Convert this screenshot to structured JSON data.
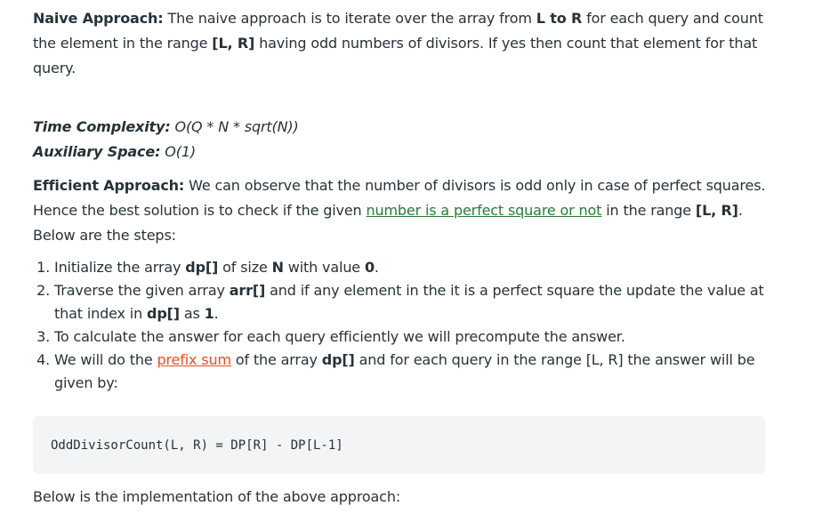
{
  "naive": {
    "label": "Naive Approach:",
    "text_1": " The naive approach is to iterate over the array from ",
    "bold_range": "L to R",
    "text_2": " for each query and count the element in the range ",
    "bold_lr": "[L, R]",
    "text_3": " having odd numbers of divisors. If yes then count that element for that query."
  },
  "complexity": {
    "time_label": "Time Complexity:",
    "time_value": " O(Q * N * sqrt(N))",
    "space_label": "Auxiliary Space:",
    "space_value": " O(1)"
  },
  "efficient": {
    "label": "Efficient Approach:",
    "text_1": " We can observe that the number of divisors is odd only in case of perfect squares. Hence the best solution is to check if the given ",
    "link_text": "number is a perfect square or not",
    "text_2": " in the range ",
    "bold_lr": "[L, R]",
    "text_3": ". Below are the steps:"
  },
  "steps": [
    {
      "t1": "Initialize the array ",
      "b1": "dp[]",
      "t2": " of size ",
      "b2": "N",
      "t3": " with value ",
      "b3": "0",
      "t4": "."
    },
    {
      "t1": "Traverse the given array ",
      "b1": "arr[]",
      "t2": " and if any element in the it is a perfect square the update the value at that index in ",
      "b2": "dp[]",
      "t3": " as ",
      "b3": "1",
      "t4": "."
    },
    {
      "t1": "To calculate the answer for each query efficiently we will precompute the answer."
    },
    {
      "t1": "We will do the ",
      "link": "prefix sum",
      "t2": " of the array ",
      "b1": "dp[]",
      "t3": " and for each query in the range [L, R] the answer will be given by:"
    }
  ],
  "code": "OddDivisorCount(L, R) = DP[R] - DP[L-1]",
  "below": "Below is the implementation of the above approach:",
  "colors": {
    "text": "#273239",
    "link_green": "#2a7a39",
    "link_orange": "#ec4e20",
    "code_bg": "#f3f4f5"
  }
}
